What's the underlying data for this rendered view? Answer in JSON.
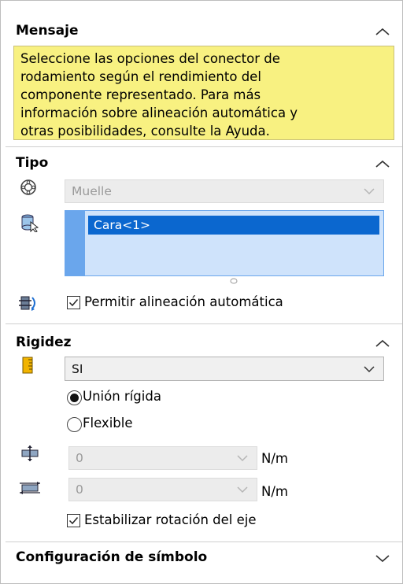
{
  "mensaje": {
    "title": "Mensaje",
    "lines": [
      "Seleccione las opciones del conector de",
      "rodamiento según el rendimiento del",
      "componente representado. Para más",
      "información sobre alineación automática y",
      "otras posibilidades, consulte la Ayuda."
    ]
  },
  "tipo": {
    "title": "Tipo",
    "type_select": "Muelle",
    "selection_list": [
      "Cara<1>"
    ],
    "auto_align_label": "Permitir alineación automática",
    "auto_align_checked": true
  },
  "rigidez": {
    "title": "Rigidez",
    "rigidity_select": "SI",
    "options": [
      "Unión rígida",
      "Flexible"
    ],
    "selected_option": "Unión rígida",
    "axial_value": "0",
    "axial_unit": "N/m",
    "radial_value": "0",
    "radial_unit": "N/m",
    "stabilize_label": "Estabilizar rotación del eje",
    "stabilize_checked": true
  },
  "config": {
    "title": "Configuración de símbolo"
  },
  "colors": {
    "message_bg": "#f8f181",
    "selection_highlight": "#0b67cf",
    "list_bg": "#cfe3fb"
  }
}
